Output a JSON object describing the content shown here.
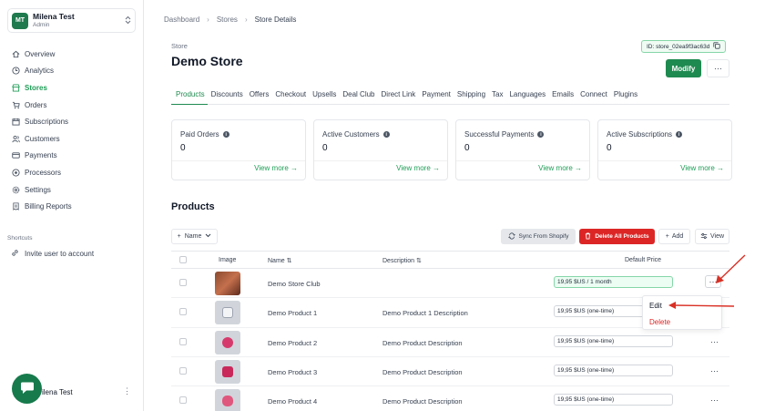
{
  "account": {
    "initials": "MT",
    "name": "Milena Test",
    "role": "Admin"
  },
  "sidebar": {
    "items": [
      {
        "label": "Overview",
        "icon": "home-icon",
        "active": false
      },
      {
        "label": "Analytics",
        "icon": "clock-icon",
        "active": false
      },
      {
        "label": "Stores",
        "icon": "store-icon",
        "active": true
      },
      {
        "label": "Orders",
        "icon": "cart-icon",
        "active": false
      },
      {
        "label": "Subscriptions",
        "icon": "calendar-icon",
        "active": false
      },
      {
        "label": "Customers",
        "icon": "users-icon",
        "active": false
      },
      {
        "label": "Payments",
        "icon": "credit-card-icon",
        "active": false
      },
      {
        "label": "Processors",
        "icon": "processor-icon",
        "active": false
      },
      {
        "label": "Settings",
        "icon": "gear-icon",
        "active": false
      },
      {
        "label": "Billing Reports",
        "icon": "receipt-icon",
        "active": false
      }
    ],
    "shortcuts_title": "Shortcuts",
    "shortcut_invite": "Invite user to account",
    "footer_user": "ilena Test"
  },
  "breadcrumb": {
    "root": "Dashboard",
    "stores": "Stores",
    "current": "Store Details"
  },
  "store": {
    "label": "Store",
    "name": "Demo Store",
    "id": "ID: store_02ea9f3ac63d",
    "modify_label": "Modify"
  },
  "tabs": [
    "Products",
    "Discounts",
    "Offers",
    "Checkout",
    "Upsells",
    "Deal Club",
    "Direct Link",
    "Payment",
    "Shipping",
    "Tax",
    "Languages",
    "Emails",
    "Connect",
    "Plugins"
  ],
  "stats": [
    {
      "title": "Paid Orders",
      "value": "0",
      "link": "View more →"
    },
    {
      "title": "Active Customers",
      "value": "0",
      "link": "View more →"
    },
    {
      "title": "Successful Payments",
      "value": "0",
      "link": "View more →"
    },
    {
      "title": "Active Subscriptions",
      "value": "0",
      "link": "View more →"
    }
  ],
  "products": {
    "title": "Products",
    "filter_label": "Name",
    "sync_label": "Sync From Shopify",
    "delete_all_label": "Delete All Products",
    "add_label": "Add",
    "view_label": "View",
    "columns": {
      "image": "Image",
      "name": "Name",
      "description": "Description",
      "price": "Default Price"
    },
    "rows": [
      {
        "name": "Demo Store Club",
        "description": "",
        "price": "19,95 $US / 1 month"
      },
      {
        "name": "Demo Product 1",
        "description": "Demo Product 1 Description",
        "price": "19,95 $US (one-time)"
      },
      {
        "name": "Demo Product 2",
        "description": "Demo Product Description",
        "price": "19,95 $US (one-time)"
      },
      {
        "name": "Demo Product 3",
        "description": "Demo Product Description",
        "price": "19,95 $US (one-time)"
      },
      {
        "name": "Demo Product 4",
        "description": "Demo Product Description",
        "price": "19,95 $US (one-time)"
      }
    ]
  },
  "row_menu": {
    "edit": "Edit",
    "delete": "Delete"
  },
  "colors": {
    "accent": "#1f8a50",
    "danger": "#dc2626",
    "annotation": "#d93025"
  }
}
